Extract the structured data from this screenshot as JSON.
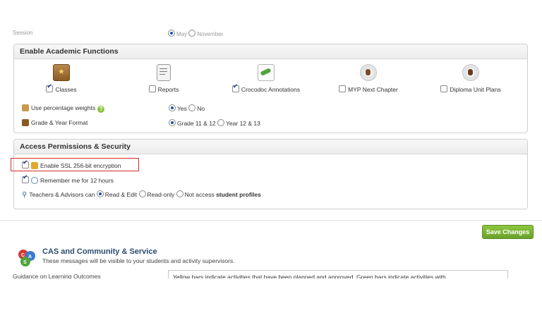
{
  "top_cut": {
    "label": "Session",
    "opt_a": "May",
    "opt_b": "November"
  },
  "academic": {
    "title": "Enable Academic Functions",
    "functions": [
      {
        "label": "Classes",
        "checked": true,
        "icon": "classes-icon"
      },
      {
        "label": "Reports",
        "checked": false,
        "icon": "reports-icon"
      },
      {
        "label": "Crocodoc Annotations",
        "checked": true,
        "icon": "crocodoc-icon"
      },
      {
        "label": "MYP Next Chapter",
        "checked": false,
        "icon": "myp-icon"
      },
      {
        "label": "Diploma Unit Plans",
        "checked": false,
        "icon": "diploma-icon"
      }
    ],
    "percentage": {
      "label": "Use percentage weights",
      "yes": "Yes",
      "no": "No",
      "selected": "Yes"
    },
    "grade": {
      "label": "Grade & Year Format",
      "opt1": "Grade 11 & 12",
      "opt2": "Year 12 & 13",
      "selected": "Grade 11 & 12"
    }
  },
  "security": {
    "title": "Access Permissions & Security",
    "ssl": {
      "label": "Enable SSL 256-bit encryption",
      "checked": true
    },
    "remember": {
      "label": "Remember me for 12 hours",
      "checked": true
    },
    "teachers": {
      "prefix": "Teachers & Advisors can",
      "opt1": "Read & Edit",
      "opt2": "Read-only",
      "opt3": "Not access",
      "suffix": "student profiles",
      "selected": "Read & Edit"
    }
  },
  "save_label": "Save Changes",
  "cas": {
    "title": "CAS and Community & Service",
    "subtitle": "These messages will be visible to your students and activity supervisors.",
    "guidance_label": "Guidance on Learning Outcomes",
    "guidance_value": "Yellow bars indicate activities that have been planned and approved. Green bars indicate activities with"
  },
  "colors": {
    "accent_green": "#8cc63f",
    "highlight_red": "#d32a2a",
    "title_blue": "#2b4b6f"
  }
}
